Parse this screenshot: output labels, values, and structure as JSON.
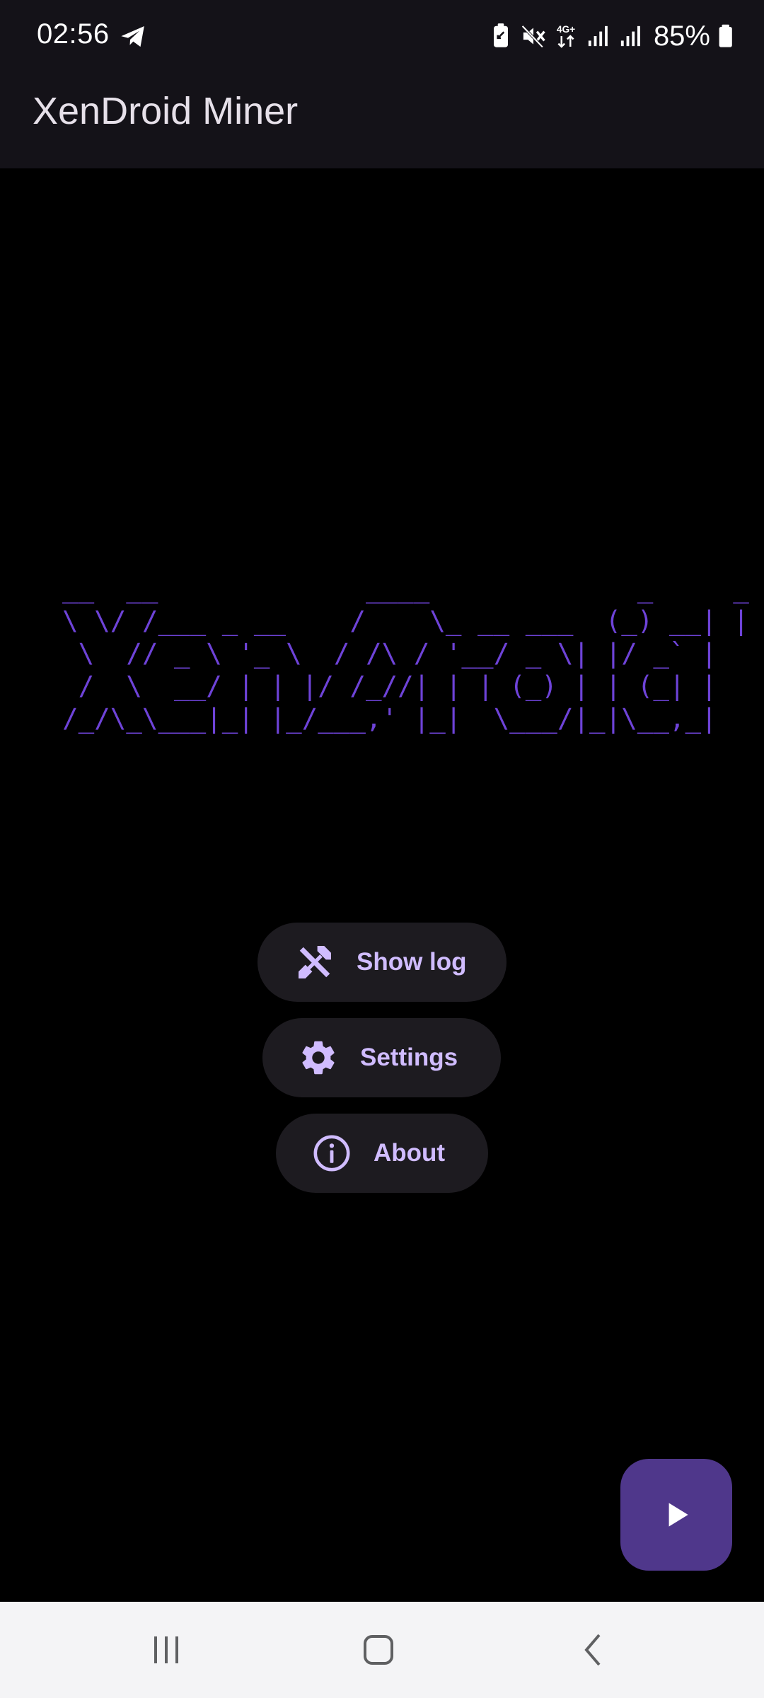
{
  "status_bar": {
    "time": "02:56",
    "battery_percent": "85%",
    "network_label": "4G+",
    "icons": [
      "telegram-icon",
      "battery-saver-icon",
      "mute-icon",
      "network-4g-icon",
      "signal-icon",
      "signal-icon",
      "battery-icon"
    ]
  },
  "app_bar": {
    "title": "XenDroid Miner"
  },
  "banner": {
    "ascii_art": "__  __             ____             _     _\n\\ \\/ /___ _ __    /    \\_ __ ___  (_) __| |\n \\  // _ \\ '_ \\  / /\\ / '__/ _ \\| |/ _` |\n /  \\  __/ | | |/ /_//| | | (_) | | (_| |\n/_/\\_\\___|_| |_/___,' |_|  \\___/|_|\\__,_|",
    "color": "#6e43d8"
  },
  "actions": {
    "show_log": {
      "label": "Show log",
      "icon": "tools-icon"
    },
    "settings": {
      "label": "Settings",
      "icon": "gear-icon"
    },
    "about": {
      "label": "About",
      "icon": "info-icon"
    }
  },
  "fab": {
    "icon": "play-icon"
  },
  "nav_bar": {
    "buttons": [
      "recents-icon",
      "home-icon",
      "back-icon"
    ]
  },
  "colors": {
    "background": "#000000",
    "app_bar": "#141218",
    "button_bg": "#1d1b20",
    "accent": "#d0bcff",
    "fab": "#4f378b",
    "nav_bar": "#f4f4f6"
  }
}
